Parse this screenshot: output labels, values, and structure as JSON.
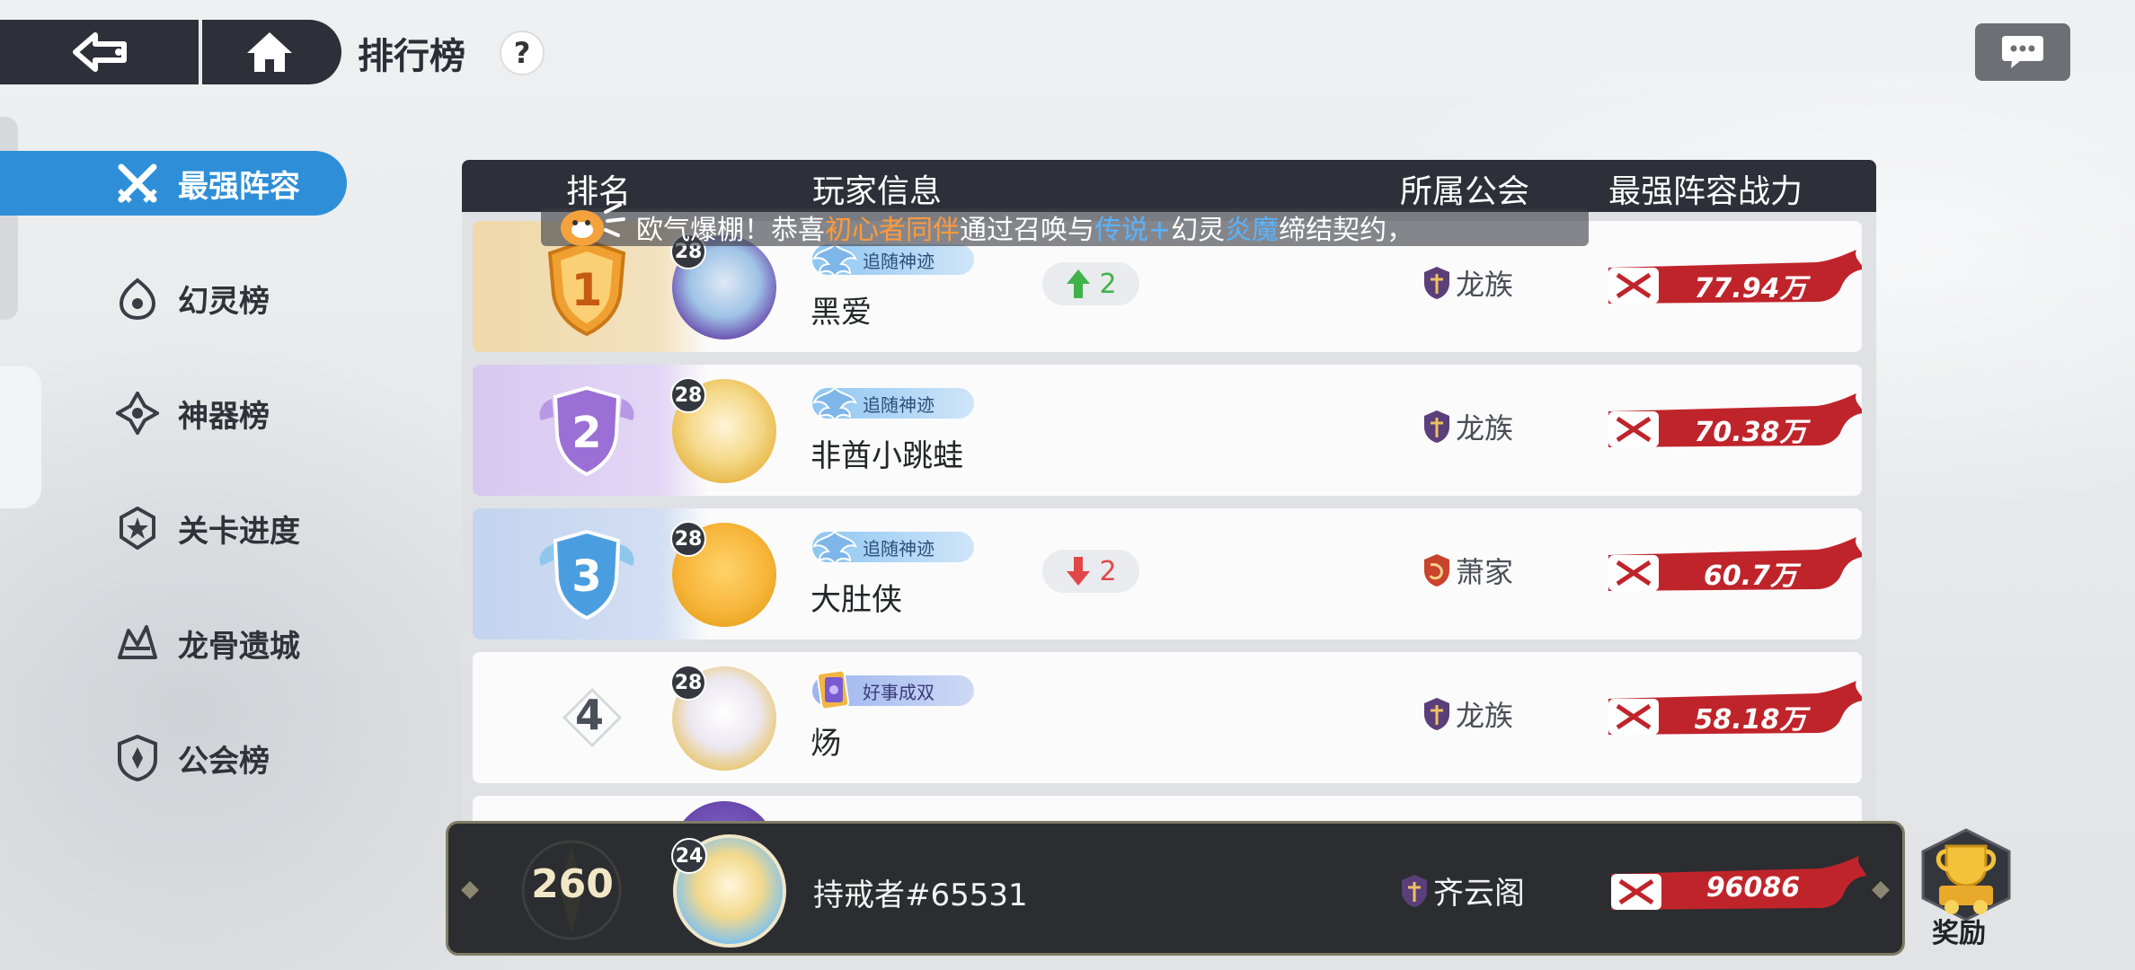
{
  "header": {
    "title": "排行榜",
    "help_label": "?"
  },
  "sidebar": {
    "items": [
      {
        "label": "最强阵容",
        "active": true,
        "icon": "crossed-swords-icon"
      },
      {
        "label": "幻灵榜",
        "active": false,
        "icon": "spirit-icon"
      },
      {
        "label": "神器榜",
        "active": false,
        "icon": "artifact-icon"
      },
      {
        "label": "关卡进度",
        "active": false,
        "icon": "stage-star-icon"
      },
      {
        "label": "龙骨遗城",
        "active": false,
        "icon": "dragon-bone-icon"
      },
      {
        "label": "公会榜",
        "active": false,
        "icon": "guild-shield-icon"
      }
    ]
  },
  "table": {
    "headers": [
      "排名",
      "玩家信息",
      "所属公会",
      "最强阵容战力"
    ],
    "rows": [
      {
        "rank": "1",
        "level": "28",
        "title_badge": "追随神迹",
        "name": "黑爱",
        "change_dir": "up",
        "change": "2",
        "guild": "龙族",
        "power": "77.94万"
      },
      {
        "rank": "2",
        "level": "28",
        "title_badge": "追随神迹",
        "name": "非酋小跳蛙",
        "change_dir": "",
        "change": "",
        "guild": "龙族",
        "power": "70.38万"
      },
      {
        "rank": "3",
        "level": "28",
        "title_badge": "追随神迹",
        "name": "大肚侠",
        "change_dir": "down",
        "change": "2",
        "guild": "萧家",
        "power": "60.7万"
      },
      {
        "rank": "4",
        "level": "28",
        "title_badge": "好事成双",
        "name": "炀",
        "change_dir": "",
        "change": "",
        "guild": "龙族",
        "power": "58.18万"
      }
    ]
  },
  "notice": {
    "prefix": "欧气爆棚！恭喜",
    "player": "初心者同伴",
    "middle": "通过召唤与",
    "rarity": "传说+",
    "middle2": "幻灵",
    "spirit": "炎魔",
    "suffix": "缔结契约，"
  },
  "my_rank": {
    "rank": "260",
    "level": "24",
    "name": "持戒者#65531",
    "guild": "齐云阁",
    "power": "96086"
  },
  "reward": {
    "label": "奖励"
  },
  "colors": {
    "accent_blue": "#2e8fd8",
    "dark_bar": "#2d3038",
    "power_red": "#c0242b",
    "up_green": "#3fb24a",
    "down_red": "#e04848"
  }
}
